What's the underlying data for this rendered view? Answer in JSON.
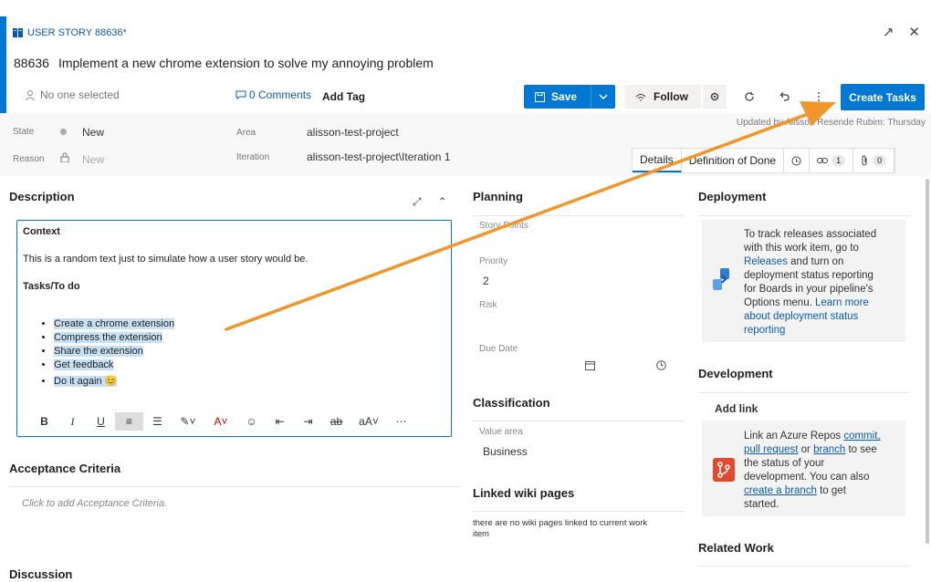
{
  "header": {
    "type_label": "USER STORY 88636*",
    "id": "88636",
    "title": "Implement a new chrome extension to solve my annoying problem",
    "expand_icon": "↗",
    "close_icon": "✕"
  },
  "meta": {
    "assignee": "No one selected",
    "comments": "0 Comments",
    "add_tag": "Add Tag"
  },
  "toolbar": {
    "save_label": "Save",
    "follow_label": "Follow",
    "create_tasks_label": "Create Tasks"
  },
  "updated": "Updated by Alisson Resende Rubim: Thursday",
  "fields": {
    "state_label": "State",
    "state_value": "New",
    "reason_label": "Reason",
    "reason_value": "New",
    "area_label": "Area",
    "area_value": "alisson-test-project",
    "iteration_label": "Iteration",
    "iteration_value": "alisson-test-project\\Iteration 1"
  },
  "tabs": {
    "details": "Details",
    "dod": "Definition of Done",
    "links_count": "1",
    "attach_count": "0"
  },
  "description": {
    "heading": "Description",
    "context": "Context",
    "context_text": "This is a random text just to simulate how a user story would be.",
    "tasks_heading": "Tasks/To do",
    "items": [
      "Create a chrome extension",
      "Compress the extension",
      "Share the extension",
      "Get feedback",
      "Do it again 😊"
    ]
  },
  "acceptance": {
    "heading": "Acceptance Criteria",
    "placeholder": "Click to add Acceptance Criteria."
  },
  "discussion": {
    "heading": "Discussion"
  },
  "planning": {
    "heading": "Planning",
    "story_points": "Story Points",
    "priority_label": "Priority",
    "priority_value": "2",
    "risk_label": "Risk",
    "due_date_label": "Due Date"
  },
  "classification": {
    "heading": "Classification",
    "value_area_label": "Value area",
    "value_area_value": "Business"
  },
  "wiki": {
    "heading": "Linked wiki pages",
    "text1": "there are no wiki pages linked to current work",
    "text2": "item"
  },
  "deployment": {
    "heading": "Deployment",
    "l1": "To track releases associated",
    "l2": "with this work item, go to",
    "l3": "Releases",
    "l3b": " and turn on",
    "l4": "deployment status reporting",
    "l5": "for Boards in your pipeline's",
    "l6": "Options menu. ",
    "l6b": "Learn more",
    "l7": "about deployment status",
    "l8": "reporting"
  },
  "development": {
    "heading": "Development",
    "add_link": "Add link",
    "l1": "Link an Azure Repos ",
    "l1b": "commit,",
    "l2": "pull request",
    "l2b": " or ",
    "l2c": "branch",
    "l2d": " to see",
    "l3": "the status of your",
    "l4": "development. You can also",
    "l5": "create a branch",
    "l5b": " to get",
    "l6": "started."
  },
  "related": {
    "heading": "Related Work"
  },
  "colors": {
    "accent": "#0078d4",
    "arrow": "#f0962a"
  }
}
